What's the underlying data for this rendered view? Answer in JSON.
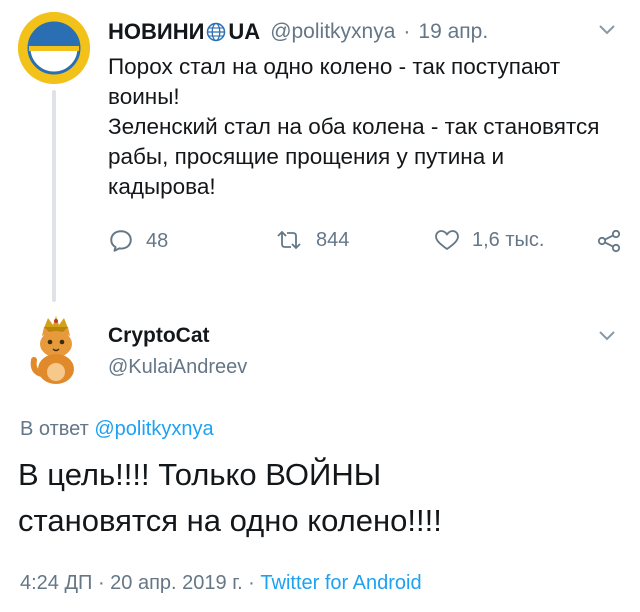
{
  "tweet": {
    "author_name": "НОВИНИ",
    "author_name_suffix": "UA",
    "author_handle": "@politkyxnya",
    "separator": "·",
    "date": "19 апр.",
    "text": "Порох стал на одно колено - так поступают воины!\nЗеленский стал на оба колена - так становятся рабы, просящие прощения у путина и кадырова!",
    "stats": {
      "replies": "48",
      "retweets": "844",
      "likes": "1,6 тыс."
    }
  },
  "reply": {
    "author_name": "CryptoCat",
    "author_handle": "@KulaiAndreev",
    "in_reply_prefix": "В ответ",
    "in_reply_mention": "@politkyxnya",
    "text": "В цель!!!! Только ВОЙНЫ\nстановятся на одно колено!!!!",
    "time_date": "4:24 ДП · 20 апр. 2019 г. · ",
    "source": "Twitter for Android"
  },
  "colors": {
    "text": "#14171a",
    "muted": "#657786",
    "link": "#1da1f2",
    "thread_line": "#dfe3e7"
  },
  "icons": [
    "globe-icon",
    "chevron-down-icon",
    "reply-icon",
    "retweet-icon",
    "like-icon",
    "share-icon"
  ]
}
